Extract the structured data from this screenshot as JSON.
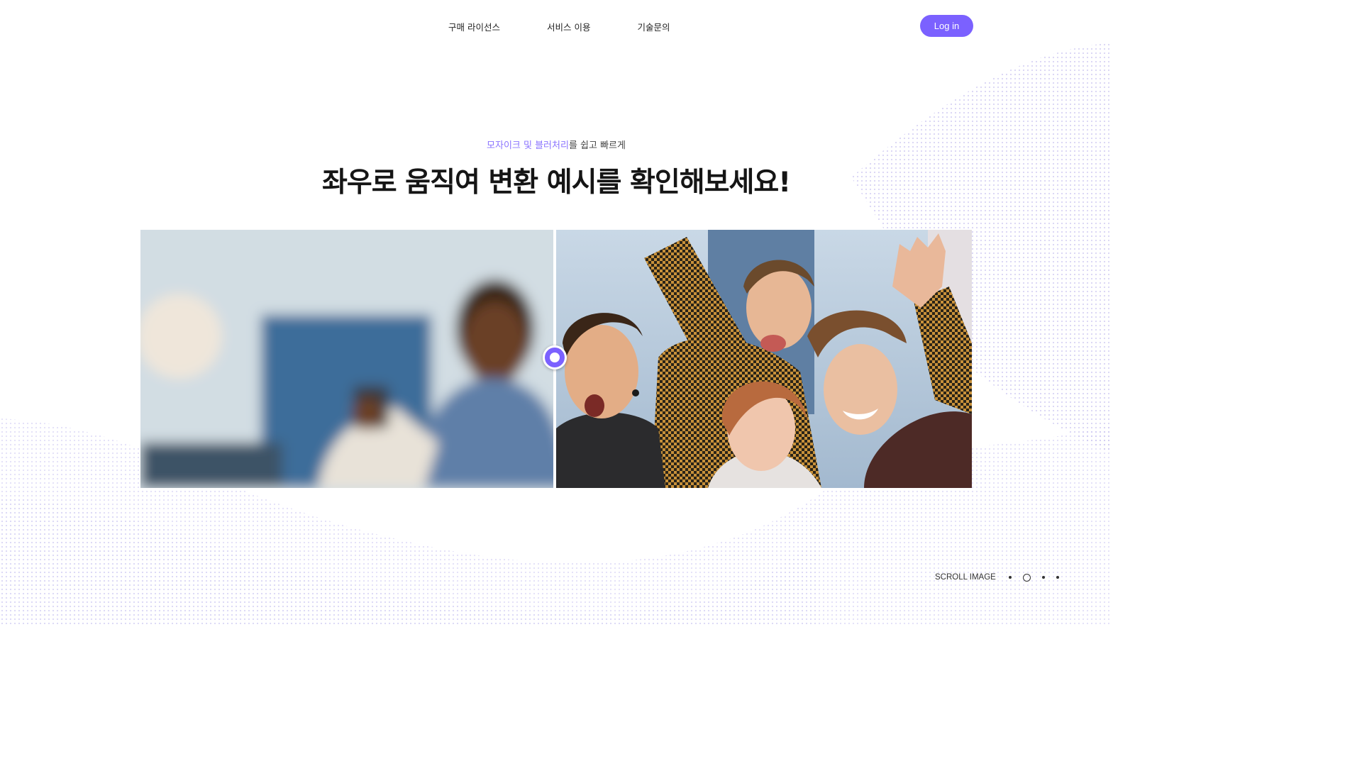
{
  "nav": {
    "links": [
      "구매 라이선스",
      "서비스 이용",
      "기술문의"
    ],
    "login_label": "Log in"
  },
  "hero": {
    "subtitle_accent": "모자이크 및 블러처리",
    "subtitle_rest": "를 쉽고 빠르게",
    "title": "좌우로 움직여 변환 예시를 확인해보세요!"
  },
  "compare": {
    "left_state": "blurred",
    "right_state": "original",
    "slider_position": 0.5
  },
  "scroll": {
    "label": "SCROLL IMAGE",
    "dots": 4,
    "active_index": 1
  },
  "colors": {
    "accent": "#7b61ff",
    "accent_text": "#8b74ff",
    "wave_dots": "#c9c3ee"
  },
  "icons": {
    "slider_handle": "compare-slider-handle-icon"
  }
}
